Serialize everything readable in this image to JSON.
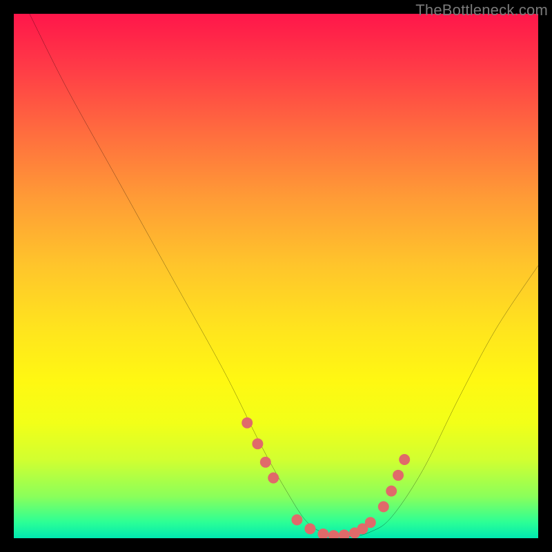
{
  "watermark": "TheBottleneck.com",
  "chart_data": {
    "type": "line",
    "title": "",
    "xlabel": "",
    "ylabel": "",
    "xlim": [
      0,
      100
    ],
    "ylim": [
      0,
      100
    ],
    "background_gradient": {
      "description": "vertical red-to-green heat gradient",
      "stops": [
        {
          "pos": 0,
          "color": "#ff164a"
        },
        {
          "pos": 50,
          "color": "#ffd924"
        },
        {
          "pos": 100,
          "color": "#00e8b0"
        }
      ]
    },
    "series": [
      {
        "name": "bottleneck-curve",
        "x": [
          3,
          10,
          20,
          30,
          40,
          47,
          52,
          56,
          60,
          64,
          68,
          72,
          78,
          85,
          92,
          100
        ],
        "y": [
          100,
          86,
          68,
          50,
          32,
          18,
          9,
          3,
          0.7,
          0.3,
          1.2,
          4,
          13,
          27,
          40,
          52
        ],
        "color": "#000000"
      }
    ],
    "marker_points": {
      "name": "highlight-dots",
      "color": "#e06a6a",
      "radius_px": 8,
      "x": [
        44.5,
        46.5,
        48.0,
        49.5,
        54.0,
        56.5,
        59.0,
        61.0,
        63.0,
        65.0,
        66.5,
        68.0,
        70.5,
        72.0,
        73.3,
        74.5
      ],
      "y": [
        22.0,
        18.0,
        14.5,
        11.5,
        3.5,
        1.8,
        0.8,
        0.5,
        0.6,
        1.0,
        1.8,
        3.0,
        6.0,
        9.0,
        12.0,
        15.0
      ]
    }
  }
}
